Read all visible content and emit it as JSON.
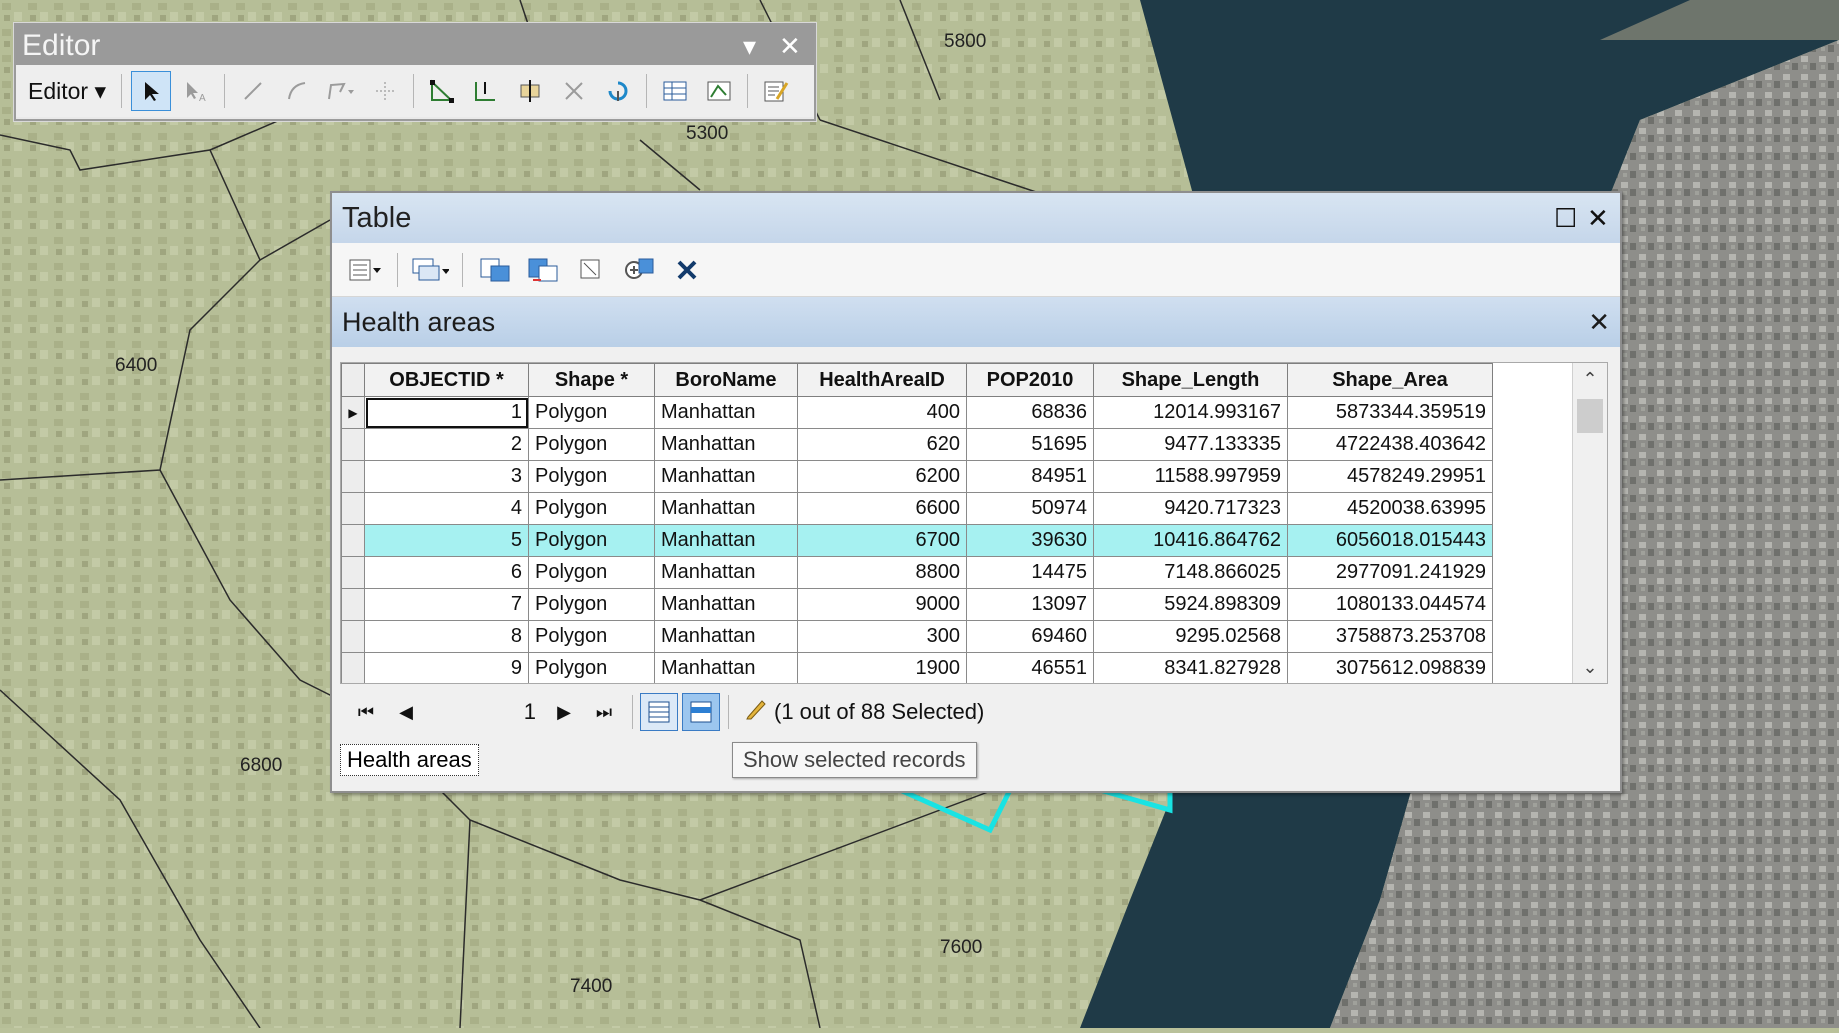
{
  "map": {
    "labels": [
      "5800",
      "5300",
      "6400",
      "6800",
      "7600",
      "7400"
    ]
  },
  "editor": {
    "title": "Editor",
    "menu_label": "Editor ▾",
    "minimize_glyph": "▾",
    "close_glyph": "✕"
  },
  "table_window": {
    "title": "Table",
    "maximize_glyph": "☐",
    "close_glyph": "✕",
    "tab_title": "Health areas",
    "tab_close_glyph": "✕",
    "columns": [
      "OBJECTID *",
      "Shape *",
      "BoroName",
      "HealthAreaID",
      "POP2010",
      "Shape_Length",
      "Shape_Area"
    ],
    "rows": [
      {
        "objectid": "1",
        "shape": "Polygon",
        "boro": "Manhattan",
        "haid": "400",
        "pop": "68836",
        "length": "12014.993167",
        "area": "5873344.359519"
      },
      {
        "objectid": "2",
        "shape": "Polygon",
        "boro": "Manhattan",
        "haid": "620",
        "pop": "51695",
        "length": "9477.133335",
        "area": "4722438.403642"
      },
      {
        "objectid": "3",
        "shape": "Polygon",
        "boro": "Manhattan",
        "haid": "6200",
        "pop": "84951",
        "length": "11588.997959",
        "area": "4578249.29951"
      },
      {
        "objectid": "4",
        "shape": "Polygon",
        "boro": "Manhattan",
        "haid": "6600",
        "pop": "50974",
        "length": "9420.717323",
        "area": "4520038.63995"
      },
      {
        "objectid": "5",
        "shape": "Polygon",
        "boro": "Manhattan",
        "haid": "6700",
        "pop": "39630",
        "length": "10416.864762",
        "area": "6056018.015443"
      },
      {
        "objectid": "6",
        "shape": "Polygon",
        "boro": "Manhattan",
        "haid": "8800",
        "pop": "14475",
        "length": "7148.866025",
        "area": "2977091.241929"
      },
      {
        "objectid": "7",
        "shape": "Polygon",
        "boro": "Manhattan",
        "haid": "9000",
        "pop": "13097",
        "length": "5924.898309",
        "area": "1080133.044574"
      },
      {
        "objectid": "8",
        "shape": "Polygon",
        "boro": "Manhattan",
        "haid": "300",
        "pop": "69460",
        "length": "9295.02568",
        "area": "3758873.253708"
      },
      {
        "objectid": "9",
        "shape": "Polygon",
        "boro": "Manhattan",
        "haid": "1900",
        "pop": "46551",
        "length": "8341.827928",
        "area": "3075612.098839"
      }
    ],
    "selected_row_index": 4,
    "current_row_marker": "▶",
    "nav": {
      "first_glyph": "⏮",
      "prev_glyph": "◀",
      "page_value": "1",
      "next_glyph": "▶",
      "last_glyph": "⏭",
      "selection_text": "(1 out of 88 Selected)"
    },
    "bottom_tab_label": "Health areas",
    "tooltip_text": "Show selected records"
  },
  "colors": {
    "selection_highlight": "#a6f1f1",
    "map_selection_outline": "#19e3e3",
    "window_header": "#c5d6ea"
  }
}
